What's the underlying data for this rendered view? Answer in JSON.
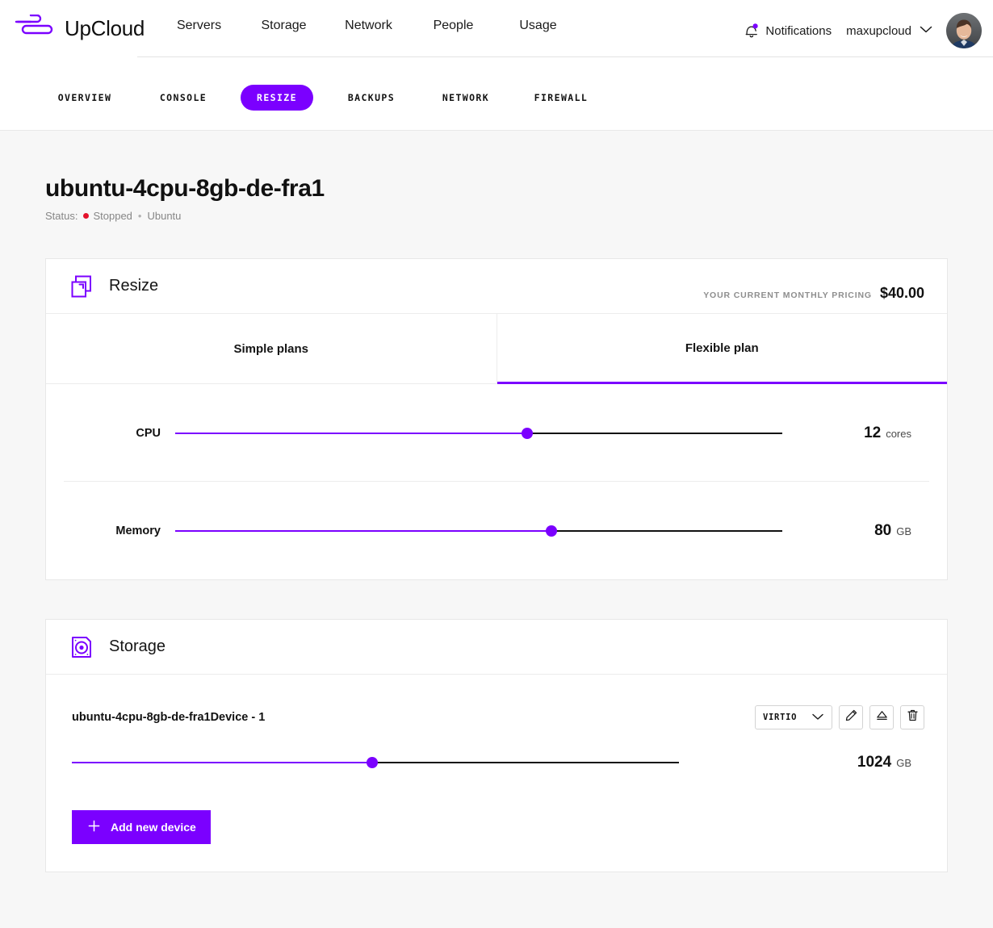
{
  "header": {
    "brand_name": "UpCloud",
    "brand_logo_icon": "upcloud-logo-icon",
    "nav": [
      {
        "label": "Servers"
      },
      {
        "label": "Storage"
      },
      {
        "label": "Network"
      },
      {
        "label": "People"
      },
      {
        "label": "Usage"
      }
    ],
    "notifications": {
      "label": "Notifications",
      "icon": "bell-icon",
      "badge_color": "#7b00ff"
    },
    "account": {
      "name": "maxupcloud",
      "chevron_icon": "chevron-down-icon",
      "avatar_icon": "user-avatar"
    }
  },
  "sub_nav": {
    "items": [
      {
        "label": "OVERVIEW",
        "active": false
      },
      {
        "label": "CONSOLE",
        "active": false
      },
      {
        "label": "RESIZE",
        "active": true
      },
      {
        "label": "BACKUPS",
        "active": false
      },
      {
        "label": "NETWORK",
        "active": false
      },
      {
        "label": "FIREWALL",
        "active": false
      }
    ],
    "active_color": "#7b00ff"
  },
  "page": {
    "title": "ubuntu-4cpu-8gb-de-fra1",
    "status_prefix": "Status:",
    "status_value": "Stopped",
    "status_color": "#e4122b",
    "separator": "•",
    "os": "Ubuntu"
  },
  "resize_card": {
    "icon": "resize-icon",
    "title": "Resize",
    "pricing_label": "YOUR CURRENT MONTHLY PRICING",
    "pricing_value": "$40.00",
    "tabs": [
      {
        "label": "Simple plans",
        "active": false
      },
      {
        "label": "Flexible plan",
        "active": true
      }
    ],
    "sliders": [
      {
        "label": "CPU",
        "value": "12",
        "unit": "cores",
        "fill_percent": 58
      },
      {
        "label": "Memory",
        "value": "80",
        "unit": "GB",
        "fill_percent": 62
      }
    ]
  },
  "storage_card": {
    "icon": "storage-disk-icon",
    "title": "Storage",
    "device": {
      "name": "ubuntu-4cpu-8gb-de-fra1Device - 1",
      "adapter": "VIRTIO",
      "adapter_chevron_icon": "chevron-down-icon",
      "edit_icon": "pencil-icon",
      "eject_icon": "eject-icon",
      "delete_icon": "trash-icon",
      "size_value": "1024",
      "size_unit": "GB",
      "fill_percent": 49.5
    },
    "add_button": {
      "label": "Add new device",
      "icon": "plus-icon",
      "color": "#7b00ff"
    }
  }
}
